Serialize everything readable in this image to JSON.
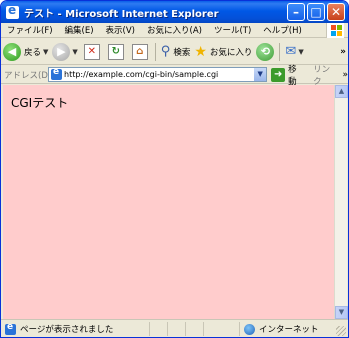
{
  "window": {
    "title": "テスト - Microsoft Internet Explorer",
    "minimize": "–",
    "maximize": "□",
    "close": "✕"
  },
  "menu": {
    "items": [
      "ファイル(F)",
      "編集(E)",
      "表示(V)",
      "お気に入り(A)",
      "ツール(T)",
      "ヘルプ(H)"
    ]
  },
  "toolbar": {
    "back_label": "戻る",
    "search_label": "検索",
    "favorites_label": "お気に入り",
    "overflow": "»"
  },
  "address": {
    "label": "アドレス(D)",
    "url": "http://example.com/cgi-bin/sample.cgi",
    "go_label": "移動",
    "links_label": "リンク",
    "overflow": "»"
  },
  "content": {
    "text": "CGIテスト",
    "background": "#ffcccc"
  },
  "status": {
    "text": "ページが表示されました",
    "zone": "インターネット"
  },
  "colors": {
    "titlebar": "#0058e6",
    "chrome": "#ece9d8"
  }
}
